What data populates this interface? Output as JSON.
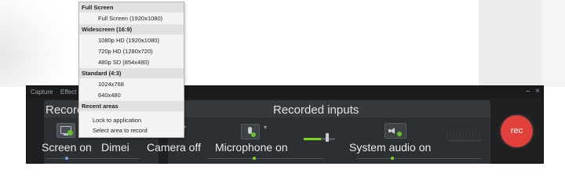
{
  "titlebar": {
    "capture_label": "Capture",
    "effects_label": "Effect",
    "minimize_glyph": "–",
    "close_glyph": "×"
  },
  "sections": {
    "recording_label": "Record",
    "inputs_label": "Recorded inputs"
  },
  "inputs": {
    "screen_label": "Screen on",
    "dimensions_label": "Dimei",
    "camera_label": "Camera off",
    "microphone_label": "Microphone on",
    "system_audio_label": "System audio on",
    "microphone_level": 0.55
  },
  "record_button_label": "rec",
  "menu": {
    "full_screen_header": "Full Screen",
    "full_screen_option": "Full Screen (1920x1080)",
    "widescreen_header": "Widescreen (16:9)",
    "opt_1080p": "1080p HD (1920x1080)",
    "opt_720p": "720p HD (1280x720)",
    "opt_480p": "480p SD (854x480)",
    "standard_header": "Standard (4:3)",
    "opt_1024": "1024x768",
    "opt_640": "640x480",
    "recent_header": "Recent areas",
    "lock_option": "Lock to application",
    "select_option": "Select area to record"
  },
  "colors": {
    "record_button": "#e2403b",
    "level_green": "#7ed321",
    "panel_bg": "#2c2f33"
  },
  "icons": {
    "screen": "monitor-icon",
    "microphone": "microphone-icon",
    "system_audio": "speaker-icon"
  }
}
